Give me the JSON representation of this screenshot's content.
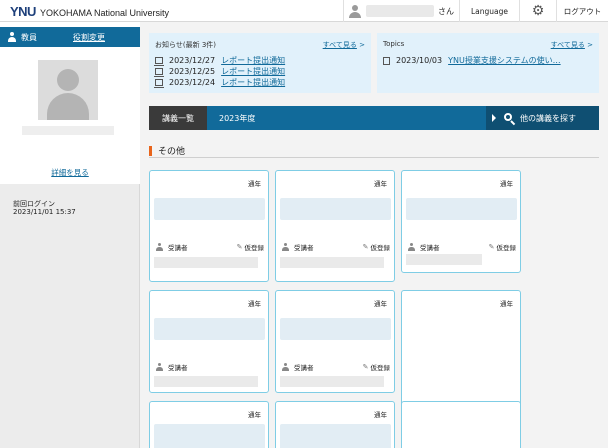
{
  "header": {
    "logo_mark": "YNU",
    "logo_text": "YOKOHAMA National University",
    "user_suffix": "さん",
    "language": "Language",
    "logout": "ログアウト"
  },
  "sidebar": {
    "role": "教員",
    "role_change": "役割変更",
    "detail_link": "詳細を見る",
    "last_login_label": "前回ログイン",
    "last_login_time": "2023/11/01 15:37"
  },
  "notices": {
    "title": "お知らせ(最新 3件)",
    "view_all": "すべて見る",
    "items": [
      {
        "date": "2023/12/27",
        "text": "レポート提出通知"
      },
      {
        "date": "2023/12/25",
        "text": "レポート提出通知"
      },
      {
        "date": "2023/12/24",
        "text": "レポート提出通知"
      }
    ]
  },
  "topics": {
    "title": "Topics",
    "view_all": "すべて見る",
    "items": [
      {
        "date": "2023/10/03",
        "text": "YNU授業支援システムの使い…"
      }
    ]
  },
  "course_bar": {
    "tab": "講義一覧",
    "year": "2023年度",
    "search": "他の講義を探す"
  },
  "section": {
    "title": "その他"
  },
  "cards": [
    {
      "frequency": "通年",
      "students_label": "受講者",
      "register_label": "仮登録"
    },
    {
      "frequency": "通年",
      "students_label": "受講者",
      "register_label": "仮登録"
    },
    {
      "frequency": "通年",
      "students_label": "受講者",
      "register_label": "仮登録"
    },
    {
      "frequency": "通年",
      "students_label": "受講者",
      "register_label": ""
    },
    {
      "frequency": "通年",
      "students_label": "受講者",
      "register_label": "仮登録"
    },
    {
      "frequency": "通年",
      "students_label": "",
      "register_label": ""
    },
    {
      "frequency": "通年",
      "students_label": "",
      "register_label": ""
    },
    {
      "frequency": "通年",
      "students_label": "",
      "register_label": ""
    },
    {
      "frequency": "",
      "students_label": "",
      "register_label": ""
    }
  ],
  "colors": {
    "primary": "#116a9a",
    "primary_dark": "#0f4f72",
    "tab_dark": "#3a3a3a",
    "accent_orange": "#e8641b",
    "card_border": "#7fcde5",
    "notice_bg": "#e1f1fb"
  },
  "icons": {
    "settings": "gear-icon",
    "search": "search-icon",
    "user": "user-icon",
    "register": "pencil-icon"
  }
}
